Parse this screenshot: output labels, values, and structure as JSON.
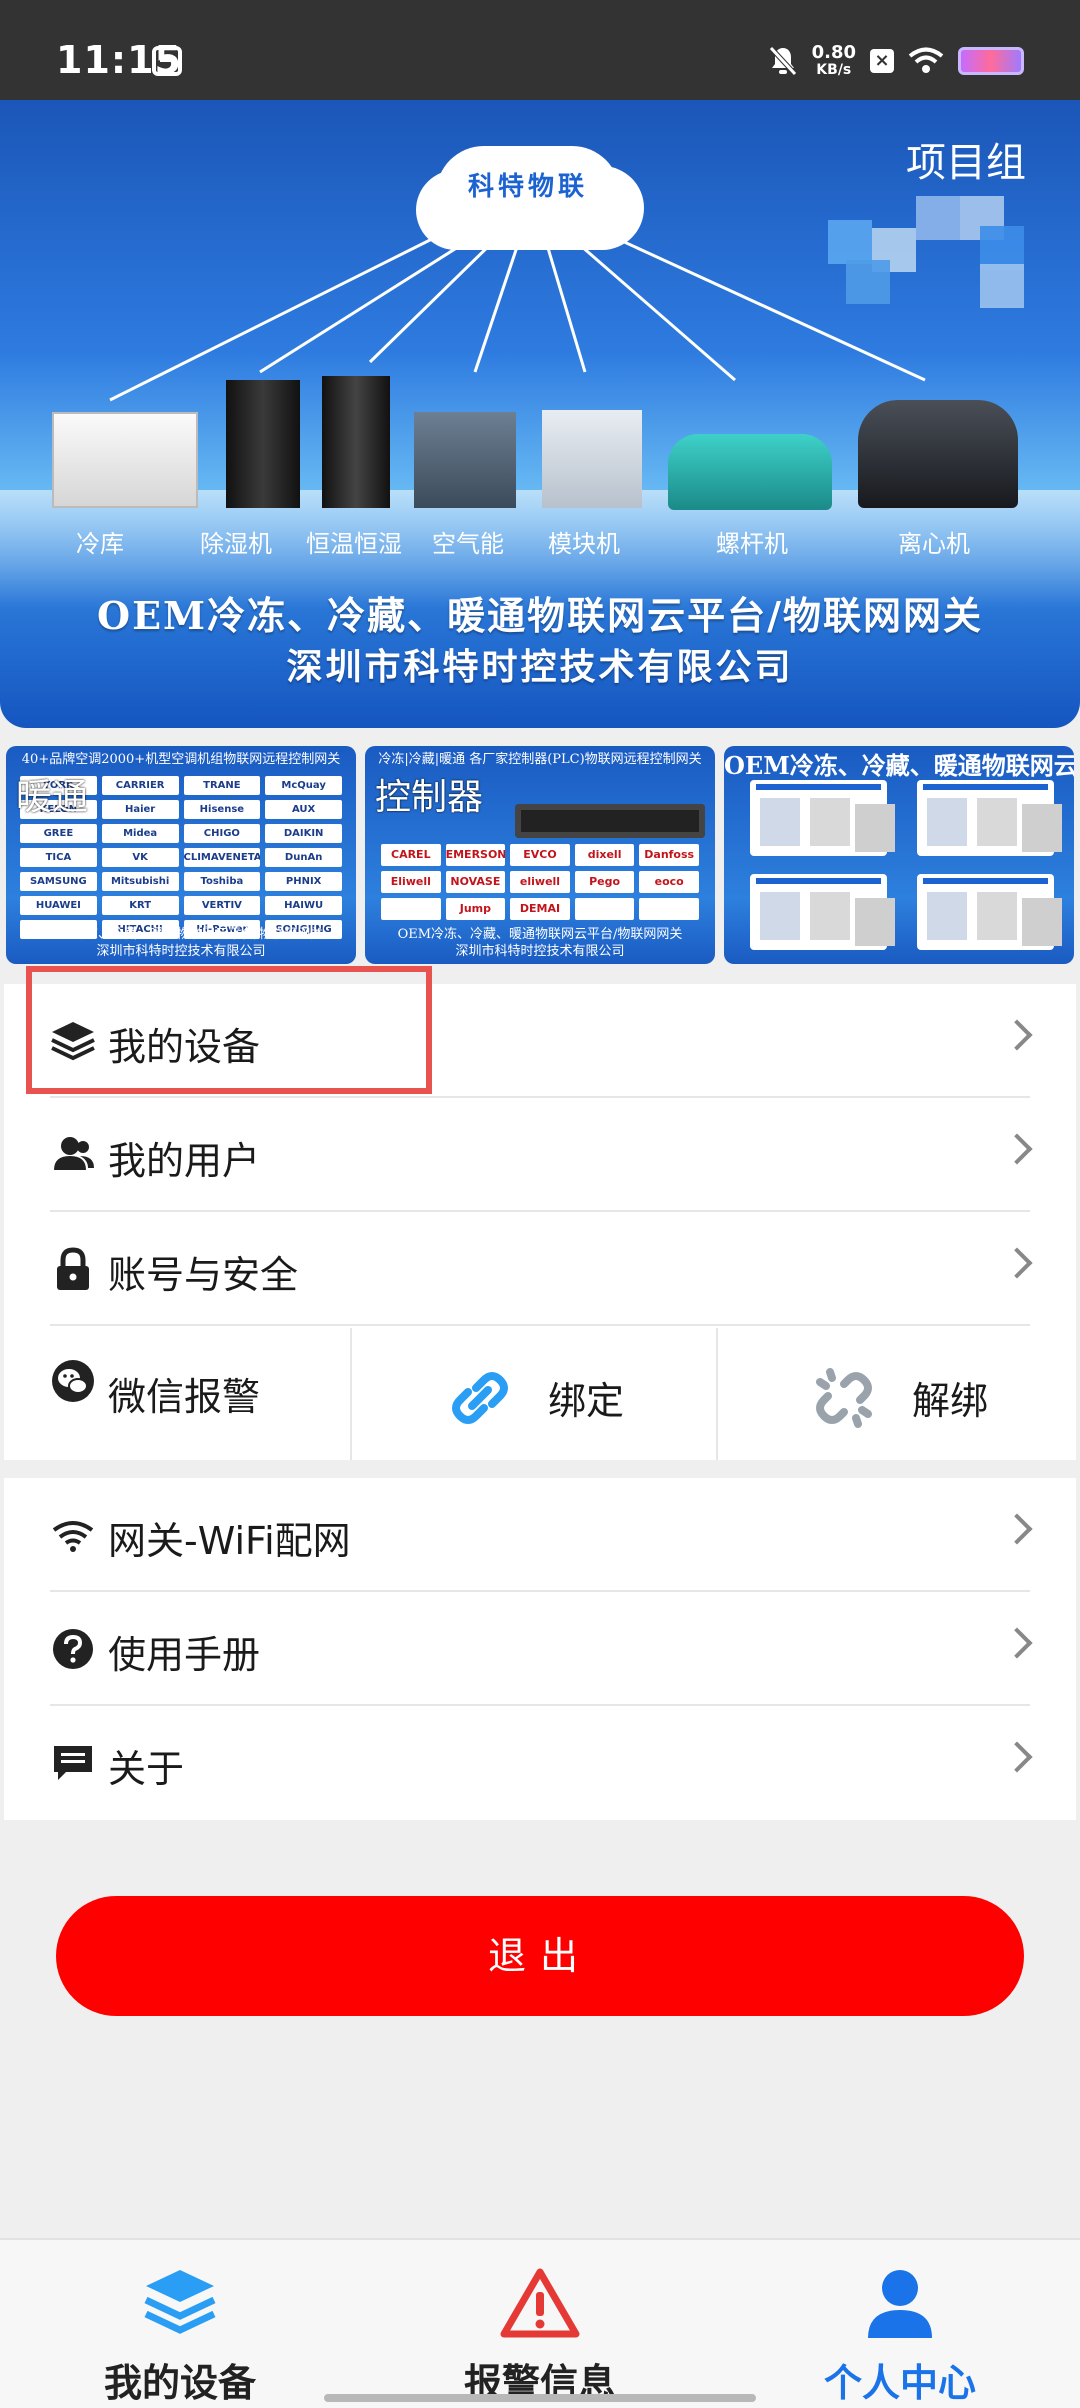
{
  "status_bar": {
    "time": "11:15",
    "net_speed_value": "0.80",
    "net_speed_unit": "KB/s"
  },
  "banner": {
    "tag": "项目组",
    "cloud_text": "科特物联",
    "equipment_labels": [
      "冷库",
      "除湿机",
      "恒温恒湿",
      "空气能",
      "模块机",
      "螺杆机",
      "离心机"
    ],
    "slogan_line1": "OEM冷冻、冷藏、暖通物联网云平台/物联网网关",
    "slogan_line2": "深圳市科特时控技术有限公司"
  },
  "thumbnails": [
    {
      "caption": "40+品牌空调2000+机型空调机组物联网远程控制网关",
      "title": "暖通",
      "logos": [
        "YORK",
        "CARRIER",
        "TRANE",
        "McQuay",
        "KELON",
        "Haier",
        "Hisense",
        "AUX",
        "GREE",
        "Midea",
        "CHIGO",
        "DAIKIN",
        "TICA",
        "VK",
        "CLIMAVENETA",
        "DunAn",
        "SAMSUNG",
        "Mitsubishi",
        "Toshiba",
        "PHNIX",
        "HUAWEI",
        "KRT",
        "VERTIV",
        "HAIWU",
        "",
        "HITACHI",
        "Hi-Power",
        "SONGJING"
      ],
      "footer_line1": "OEM冷冻、冷藏、暖通物联网云平台/物联网网关",
      "footer_line2": "深圳市科特时控技术有限公司"
    },
    {
      "caption": "冷冻|冷藏|暖通 各厂家控制器(PLC)物联网远程控制网关",
      "title": "控制器",
      "logos": [
        "CAREL",
        "EMERSON",
        "EVCO",
        "dixell",
        "Danfoss",
        "Eliwell",
        "NOVASE",
        "eliwell",
        "Pego",
        "eoco",
        "",
        "Jump",
        "DEMAI",
        "",
        ""
      ],
      "footer_line1": "OEM冷冻、冷藏、暖通物联网云平台/物联网网关",
      "footer_line2": "深圳市科特时控技术有限公司"
    },
    {
      "caption": "OEM冷冻、冷藏、暖通物联网云平台",
      "title": ""
    }
  ],
  "menu_group1": {
    "items": [
      {
        "label": "我的设备",
        "icon": "layers-icon"
      },
      {
        "label": "我的用户",
        "icon": "users-icon"
      },
      {
        "label": "账号与安全",
        "icon": "lock-icon"
      }
    ],
    "wechat_label": "微信报警",
    "bind_label": "绑定",
    "unbind_label": "解绑"
  },
  "menu_group2": {
    "items": [
      {
        "label": "网关-WiFi配网",
        "icon": "wifi-icon"
      },
      {
        "label": "使用手册",
        "icon": "help-icon"
      },
      {
        "label": "关于",
        "icon": "message-icon"
      }
    ]
  },
  "logout_label": "退出",
  "bottom_nav": {
    "items": [
      {
        "label": "我的设备",
        "icon": "layers-icon",
        "active": false
      },
      {
        "label": "报警信息",
        "icon": "alert-icon",
        "active": false
      },
      {
        "label": "个人中心",
        "icon": "person-icon",
        "active": true
      }
    ],
    "active_color": "#1a73e8",
    "inactive_color": "#222222"
  },
  "colors": {
    "accent_blue": "#1a73e8",
    "logout_red": "#ff0000",
    "highlight_red": "#e9534f",
    "link_blue": "#2a9df4"
  }
}
